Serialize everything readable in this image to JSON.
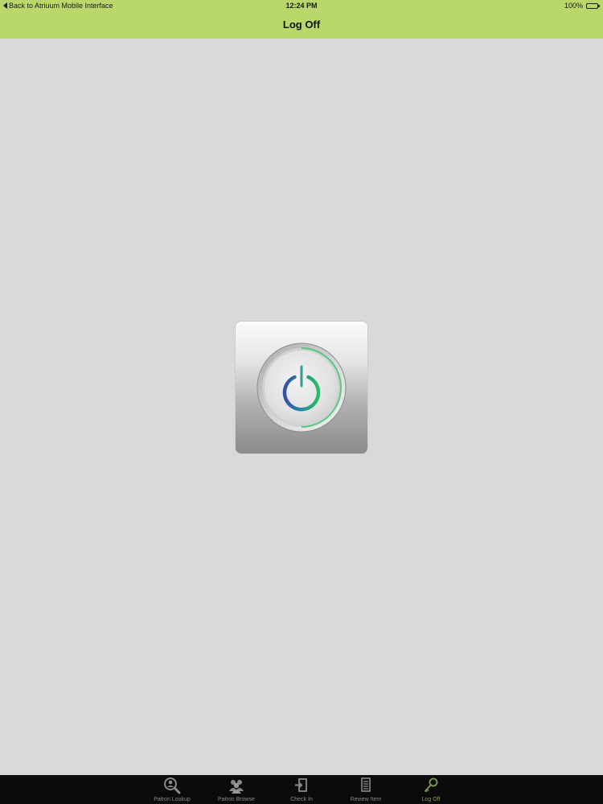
{
  "status_bar": {
    "back_label": "Back to Atriuum Mobile Interface",
    "time": "12:24 PM",
    "battery": "100%",
    "battery_level": 1.0
  },
  "nav": {
    "title": "Log Off"
  },
  "main": {
    "power_button_icon": "power-icon"
  },
  "tabs": [
    {
      "label": "Patron Lookup",
      "icon": "magnifier-person-icon",
      "active": false
    },
    {
      "label": "Patron Browse",
      "icon": "people-group-icon",
      "active": false
    },
    {
      "label": "Check In",
      "icon": "check-in-door-icon",
      "active": false
    },
    {
      "label": "Review Item",
      "icon": "document-list-icon",
      "active": false
    },
    {
      "label": "Log Off",
      "icon": "key-icon",
      "active": true
    }
  ],
  "colors": {
    "header": "#b9d76b",
    "background": "#d9d8db",
    "tab_bar": "#0b0b0b",
    "active_tab": "#7f9a52",
    "power_green": "#2bb24c",
    "power_blue": "#2f5aa8"
  }
}
